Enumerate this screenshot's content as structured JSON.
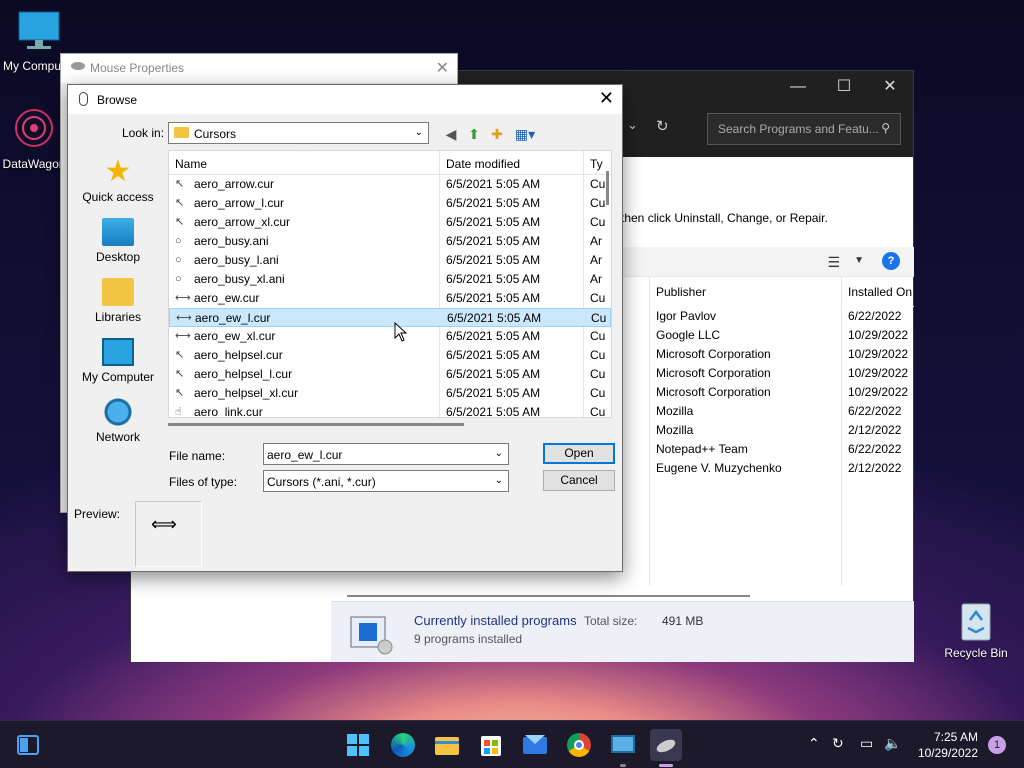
{
  "desktop": {
    "icons": [
      {
        "label": "My Computer"
      },
      {
        "label": "DataWagon"
      }
    ],
    "recycle_bin": "Recycle Bin"
  },
  "control_panel": {
    "search_placeholder": "Search Programs and Featu...",
    "hint": "then click Uninstall, Change, or Repair.",
    "columns": {
      "publisher": "Publisher",
      "installed_on": "Installed On"
    },
    "rows": [
      {
        "publisher": "Igor Pavlov",
        "installed_on": "6/22/2022"
      },
      {
        "publisher": "Google LLC",
        "installed_on": "10/29/2022"
      },
      {
        "publisher": "Microsoft Corporation",
        "installed_on": "10/29/2022"
      },
      {
        "publisher": "Microsoft Corporation",
        "installed_on": "10/29/2022"
      },
      {
        "publisher": "Microsoft Corporation",
        "installed_on": "10/29/2022"
      },
      {
        "publisher": "Mozilla",
        "installed_on": "6/22/2022"
      },
      {
        "publisher": "Mozilla",
        "installed_on": "2/12/2022"
      },
      {
        "publisher": "Notepad++ Team",
        "installed_on": "6/22/2022"
      },
      {
        "publisher": "Eugene V. Muzychenko",
        "installed_on": "2/12/2022"
      }
    ],
    "status": {
      "title": "Currently installed programs",
      "total_label": "Total size:",
      "total_value": "491 MB",
      "count": "9 programs installed"
    }
  },
  "mouse_properties": {
    "title": "Mouse Properties"
  },
  "browse": {
    "title": "Browse",
    "look_in_label": "Look in:",
    "look_in_value": "Cursors",
    "places": [
      "Quick access",
      "Desktop",
      "Libraries",
      "My Computer",
      "Network"
    ],
    "columns": {
      "name": "Name",
      "date": "Date modified",
      "type": "Ty"
    },
    "files": [
      {
        "name": "aero_arrow.cur",
        "date": "6/5/2021 5:05 AM",
        "type": "Cu",
        "icon": "arrow-cursor-icon",
        "glyph": "↖"
      },
      {
        "name": "aero_arrow_l.cur",
        "date": "6/5/2021 5:05 AM",
        "type": "Cu",
        "icon": "arrow-cursor-icon",
        "glyph": "↖"
      },
      {
        "name": "aero_arrow_xl.cur",
        "date": "6/5/2021 5:05 AM",
        "type": "Cu",
        "icon": "arrow-cursor-icon",
        "glyph": "↖"
      },
      {
        "name": "aero_busy.ani",
        "date": "6/5/2021 5:05 AM",
        "type": "Ar",
        "icon": "busy-cursor-icon",
        "glyph": "○"
      },
      {
        "name": "aero_busy_l.ani",
        "date": "6/5/2021 5:05 AM",
        "type": "Ar",
        "icon": "busy-cursor-icon",
        "glyph": "○"
      },
      {
        "name": "aero_busy_xl.ani",
        "date": "6/5/2021 5:05 AM",
        "type": "Ar",
        "icon": "busy-cursor-icon",
        "glyph": "○"
      },
      {
        "name": "aero_ew.cur",
        "date": "6/5/2021 5:05 AM",
        "type": "Cu",
        "icon": "resize-ew-icon",
        "glyph": "⟷"
      },
      {
        "name": "aero_ew_l.cur",
        "date": "6/5/2021 5:05 AM",
        "type": "Cu",
        "icon": "resize-ew-icon",
        "glyph": "⟷",
        "selected": true
      },
      {
        "name": "aero_ew_xl.cur",
        "date": "6/5/2021 5:05 AM",
        "type": "Cu",
        "icon": "resize-ew-icon",
        "glyph": "⟷"
      },
      {
        "name": "aero_helpsel.cur",
        "date": "6/5/2021 5:05 AM",
        "type": "Cu",
        "icon": "help-cursor-icon",
        "glyph": "↖"
      },
      {
        "name": "aero_helpsel_l.cur",
        "date": "6/5/2021 5:05 AM",
        "type": "Cu",
        "icon": "help-cursor-icon",
        "glyph": "↖"
      },
      {
        "name": "aero_helpsel_xl.cur",
        "date": "6/5/2021 5:05 AM",
        "type": "Cu",
        "icon": "help-cursor-icon",
        "glyph": "↖"
      },
      {
        "name": "aero_link.cur",
        "date": "6/5/2021 5:05 AM",
        "type": "Cu",
        "icon": "link-cursor-icon",
        "glyph": "☝"
      }
    ],
    "file_name_label": "File name:",
    "file_name_value": "aero_ew_l.cur",
    "file_type_label": "Files of type:",
    "file_type_value": "Cursors (*.ani, *.cur)",
    "open_label": "Open",
    "cancel_label": "Cancel",
    "preview_label": "Preview:"
  },
  "taskbar": {
    "time": "7:25 AM",
    "date": "10/29/2022",
    "notification_count": "1"
  },
  "colors": {
    "accent": "#0078d7",
    "selection": "#cce8ff"
  }
}
